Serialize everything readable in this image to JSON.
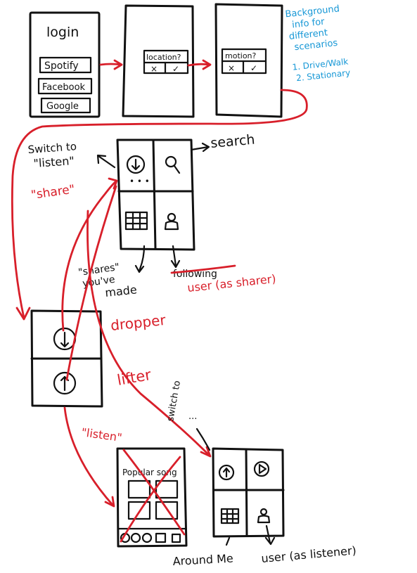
{
  "colors": {
    "ink": "#111111",
    "red": "#d81f2a",
    "blue": "#1597d6"
  },
  "login": {
    "title": "login",
    "buttons": [
      "Spotify",
      "Facebook",
      "Google"
    ]
  },
  "location_screen": {
    "prompt": "location?",
    "no": "×",
    "yes": "✓"
  },
  "motion_screen": {
    "prompt": "motion?",
    "no": "×",
    "yes": "✓"
  },
  "background_note": {
    "lines": [
      "Background",
      "info for",
      "different",
      "scenarios"
    ],
    "items": [
      "1. Drive/Walk",
      "2. Stationary"
    ]
  },
  "share_screen": {
    "annotations": {
      "switch_line1": "Switch to",
      "switch_line2": "\"listen\"",
      "search": "search",
      "share": "\"share\"",
      "shares_line1": "\"shares\"",
      "shares_line2": "you've",
      "shares_line3": "made",
      "following_struck": "following",
      "user_sharer": "user (as sharer)"
    },
    "icons": [
      "dropper-icon",
      "search-icon",
      "map-grid-icon",
      "user-icon"
    ]
  },
  "mode_screen": {
    "dropper": "dropper",
    "lifter": "lifter",
    "listen": "\"listen\""
  },
  "popular_screen": {
    "title": "Popular song"
  },
  "listen_screen": {
    "switch_to": "switch to",
    "dots": "...",
    "around_me": "Around Me",
    "user_listener": "user (as listener)"
  }
}
